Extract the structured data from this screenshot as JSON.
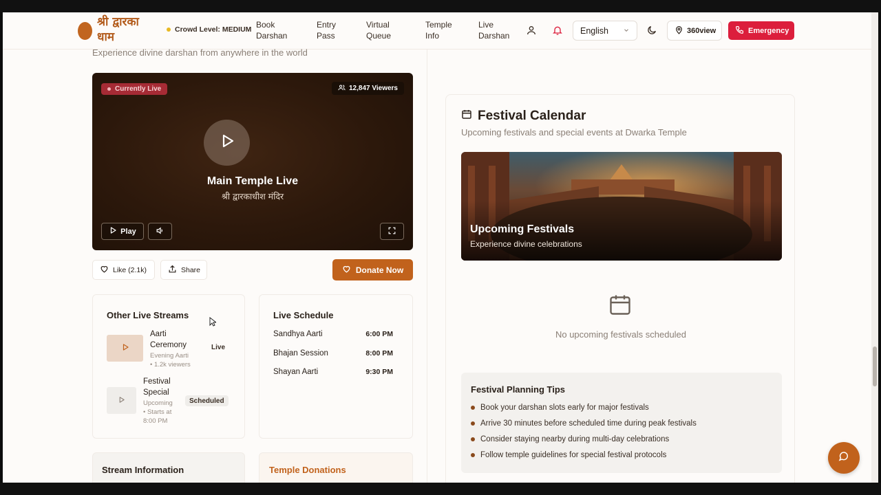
{
  "header": {
    "logo_text": "श्री द्वारका धाम",
    "crowd_level": "Crowd Level: MEDIUM",
    "nav": [
      {
        "line1": "Book",
        "line2": "Darshan"
      },
      {
        "line1": "Entry",
        "line2": "Pass"
      },
      {
        "line1": "Virtual",
        "line2": "Queue"
      },
      {
        "line1": "Temple",
        "line2": "Info"
      },
      {
        "line1": "Live",
        "line2": "Darshan"
      }
    ],
    "language": "English",
    "view360_label": "360view",
    "emergency_label": "Emergency"
  },
  "live": {
    "subtitle": "Experience divine darshan from anywhere in the world",
    "badge": "Currently Live",
    "viewers": "12,847 Viewers",
    "title": "Main Temple Live",
    "subtitle_hindi": "श्री द्वारकाधीश मंदिर",
    "play_label": "Play",
    "like_label": "Like (2.1k)",
    "share_label": "Share",
    "donate_label": "Donate Now"
  },
  "other_streams": {
    "title": "Other Live Streams",
    "items": [
      {
        "name_line1": "Aarti",
        "name_line2": "Ceremony",
        "meta_line1": "Evening Aarti",
        "meta_line2": "• 1.2k viewers",
        "status": "Live"
      },
      {
        "name_line1": "Festival",
        "name_line2": "Special",
        "meta_line1": "Upcoming",
        "meta_line2": "• Starts at",
        "meta_line3": "8:00 PM",
        "status": "Scheduled"
      }
    ]
  },
  "schedule": {
    "title": "Live Schedule",
    "items": [
      {
        "name": "Sandhya Aarti",
        "time": "6:00 PM"
      },
      {
        "name": "Bhajan Session",
        "time": "8:00 PM"
      },
      {
        "name": "Shayan Aarti",
        "time": "9:30 PM"
      }
    ]
  },
  "stream_info": {
    "title": "Stream Information"
  },
  "donations": {
    "title": "Temple Donations"
  },
  "festival": {
    "title": "Festival Calendar",
    "subtitle": "Upcoming festivals and special events at Dwarka Temple",
    "banner_title": "Upcoming Festivals",
    "banner_sub": "Experience divine celebrations",
    "empty_text": "No upcoming festivals scheduled",
    "tips_title": "Festival Planning Tips",
    "tips": [
      "Book your darshan slots early for major festivals",
      "Arrive 30 minutes before scheduled time during peak festivals",
      "Consider staying nearby during multi-day celebrations",
      "Follow temple guidelines for special festival protocols"
    ]
  },
  "colors": {
    "accent": "#c1621c",
    "emergency": "#dc1e3c",
    "live_badge": "#a62b35"
  }
}
